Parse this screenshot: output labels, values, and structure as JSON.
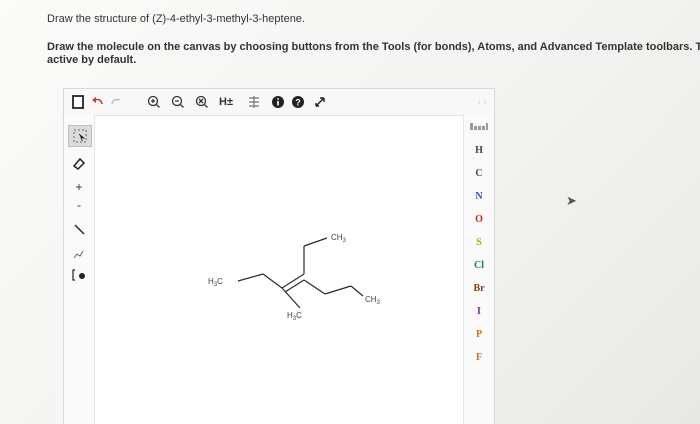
{
  "question": {
    "title": "Draw the structure of (Z)-4-ethyl-3-methyl-3-heptene.",
    "instruction": "Draw the molecule on the canvas by choosing buttons from the Tools (for bonds), Atoms, and Advanced Template toolbars. T",
    "instruction_line2": "active by default."
  },
  "toolbar": {
    "new_icon": "document-icon",
    "undo_icon": "undo-icon",
    "redo_icon": "redo-icon",
    "zoom_in_icon": "zoom-in-icon",
    "zoom_out_icon": "zoom-out-icon",
    "zoom_reset_icon": "zoom-reset-icon",
    "hydrogens_label": "H±",
    "info_icon": "info-icon",
    "help_icon": "help-icon",
    "fullscreen_icon": "expand-icon"
  },
  "atoms": [
    "H",
    "C",
    "N",
    "O",
    "S",
    "Cl",
    "Br",
    "I",
    "P",
    "F"
  ],
  "atom_colors": {
    "H": "#444444",
    "C": "#444444",
    "N": "#3050d0",
    "O": "#d02020",
    "S": "#b8a000",
    "Cl": "#208040",
    "Br": "#8b3a1a",
    "I": "#7030a0",
    "P": "#d07020",
    "F": "#d07020"
  },
  "molecule_labels": {
    "top_methyl": "CH3",
    "left_methyl": "H3C",
    "right_methyl": "CH3",
    "bottom_methyl": "H3C"
  }
}
